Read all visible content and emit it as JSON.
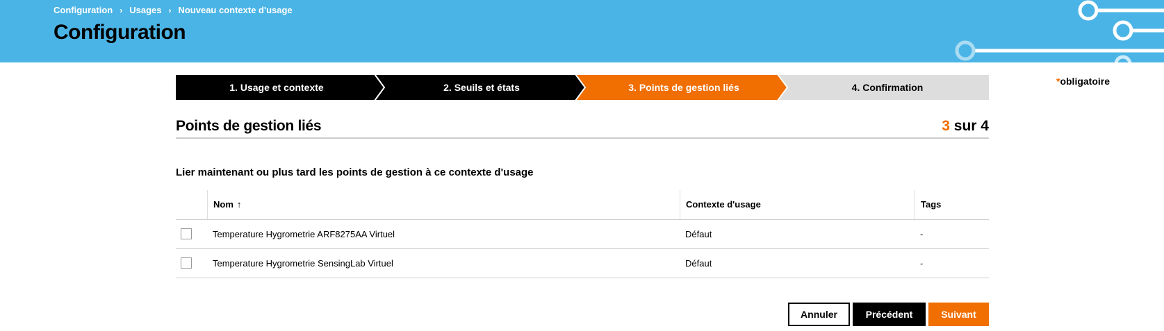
{
  "breadcrumb": [
    "Configuration",
    "Usages",
    "Nouveau contexte d'usage"
  ],
  "page_title": "Configuration",
  "required_note": {
    "star": "*",
    "label": "obligatoire"
  },
  "stepper": [
    {
      "label": "1. Usage et contexte",
      "state": "done"
    },
    {
      "label": "2. Seuils et états",
      "state": "done"
    },
    {
      "label": "3. Points de gestion liés",
      "state": "active"
    },
    {
      "label": "4. Confirmation",
      "state": "todo"
    }
  ],
  "section": {
    "title": "Points de gestion liés",
    "step_current": "3",
    "step_of": "sur 4",
    "instruction": "Lier maintenant ou plus tard les points de gestion à ce contexte d'usage"
  },
  "table": {
    "columns": {
      "name": "Nom",
      "sort_icon": "↑",
      "context": "Contexte d'usage",
      "tags": "Tags"
    },
    "rows": [
      {
        "checked": false,
        "name": "Temperature Hygrometrie ARF8275AA Virtuel",
        "context": "Défaut",
        "tags": "-"
      },
      {
        "checked": false,
        "name": "Temperature Hygrometrie SensingLab Virtuel",
        "context": "Défaut",
        "tags": "-"
      }
    ]
  },
  "buttons": {
    "cancel": "Annuler",
    "previous": "Précédent",
    "next": "Suivant"
  },
  "colors": {
    "header": "#4bb4e6",
    "accent": "#f16e00",
    "step_done": "#000000",
    "step_todo": "#dddddd"
  }
}
